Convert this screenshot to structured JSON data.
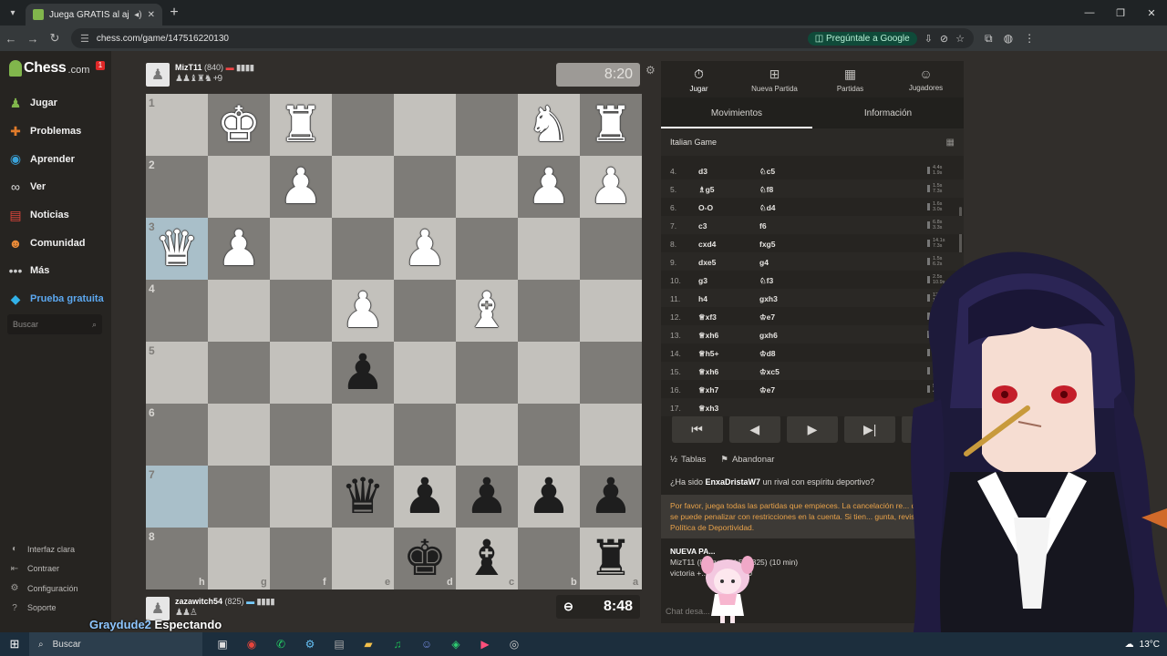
{
  "browser": {
    "tab_title": "Juega GRATIS al ajedrez on",
    "url": "chess.com/game/147516220130",
    "google_chip": "Pregúntale a Google"
  },
  "sidebar": {
    "logo": "Chess",
    "logo_suffix": ".com",
    "notification_count": "1",
    "items": [
      {
        "label": "Jugar",
        "icon": "play-pawn-icon",
        "color": "#81b64c"
      },
      {
        "label": "Problemas",
        "icon": "puzzle-icon",
        "color": "#e07b2b"
      },
      {
        "label": "Aprender",
        "icon": "learn-icon",
        "color": "#3aa2d9"
      },
      {
        "label": "Ver",
        "icon": "binoculars-icon",
        "color": "#dddddd"
      },
      {
        "label": "Noticias",
        "icon": "news-icon",
        "color": "#e0473c"
      },
      {
        "label": "Comunidad",
        "icon": "community-icon",
        "color": "#e98a38"
      },
      {
        "label": "Más",
        "icon": "more-icon",
        "color": "#cccccc"
      },
      {
        "label": "Prueba gratuita",
        "icon": "diamond-icon",
        "color": "#32b1e8"
      }
    ],
    "search_placeholder": "Buscar",
    "footer": [
      {
        "label": "Interfaz clara",
        "icon": "theme-icon"
      },
      {
        "label": "Contraer",
        "icon": "collapse-icon"
      },
      {
        "label": "Configuración",
        "icon": "settings-icon"
      },
      {
        "label": "Soporte",
        "icon": "help-icon"
      }
    ]
  },
  "top_player": {
    "name": "MizT11",
    "rating": "(840)",
    "captured": "♟♟♝♜♞ +9",
    "clock": "8:20"
  },
  "bottom_player": {
    "name": "zazawitch54",
    "rating": "(825)",
    "captured": "♟♟♙",
    "clock": "8:48"
  },
  "board": {
    "ranks": [
      "1",
      "2",
      "3",
      "4",
      "5",
      "6",
      "7",
      "8"
    ],
    "files": [
      "h",
      "g",
      "f",
      "e",
      "d",
      "c",
      "b",
      "a"
    ],
    "highlight": [
      [
        2,
        0
      ],
      [
        6,
        0
      ]
    ],
    "pieces": [
      {
        "r": 0,
        "c": 1,
        "p": "♚",
        "side": "w"
      },
      {
        "r": 0,
        "c": 2,
        "p": "♜",
        "side": "w"
      },
      {
        "r": 0,
        "c": 6,
        "p": "♞",
        "side": "w"
      },
      {
        "r": 0,
        "c": 7,
        "p": "♜",
        "side": "w"
      },
      {
        "r": 1,
        "c": 2,
        "p": "♟",
        "side": "w"
      },
      {
        "r": 1,
        "c": 6,
        "p": "♟",
        "side": "w"
      },
      {
        "r": 1,
        "c": 7,
        "p": "♟",
        "side": "w"
      },
      {
        "r": 2,
        "c": 0,
        "p": "♛",
        "side": "w"
      },
      {
        "r": 2,
        "c": 1,
        "p": "♟",
        "side": "w"
      },
      {
        "r": 2,
        "c": 4,
        "p": "♟",
        "side": "w"
      },
      {
        "r": 3,
        "c": 3,
        "p": "♟",
        "side": "w"
      },
      {
        "r": 3,
        "c": 5,
        "p": "♝",
        "side": "w"
      },
      {
        "r": 4,
        "c": 3,
        "p": "♟",
        "side": "b"
      },
      {
        "r": 6,
        "c": 3,
        "p": "♛",
        "side": "b"
      },
      {
        "r": 6,
        "c": 4,
        "p": "♟",
        "side": "b"
      },
      {
        "r": 6,
        "c": 5,
        "p": "♟",
        "side": "b"
      },
      {
        "r": 6,
        "c": 6,
        "p": "♟",
        "side": "b"
      },
      {
        "r": 6,
        "c": 7,
        "p": "♟",
        "side": "b"
      },
      {
        "r": 7,
        "c": 4,
        "p": "♚",
        "side": "b"
      },
      {
        "r": 7,
        "c": 5,
        "p": "♝",
        "side": "b"
      },
      {
        "r": 7,
        "c": 7,
        "p": "♜",
        "side": "b"
      }
    ]
  },
  "panel": {
    "tabs": [
      {
        "label": "Jugar",
        "icon": "stopwatch-icon"
      },
      {
        "label": "Nueva Partida",
        "icon": "plus-icon"
      },
      {
        "label": "Partidas",
        "icon": "grid-icon"
      },
      {
        "label": "Jugadores",
        "icon": "players-icon"
      }
    ],
    "subtabs": [
      "Movimientos",
      "Información"
    ],
    "opening": "Italian Game",
    "moves": [
      {
        "n": "4.",
        "w": "d3",
        "b": "♘c5",
        "t": "4.4s\n1.9s"
      },
      {
        "n": "5.",
        "w": "♗g5",
        "b": "♘f8",
        "t": "1.5s\n7.3s"
      },
      {
        "n": "6.",
        "w": "O-O",
        "b": "♘d4",
        "t": "1.6s\n3.0s"
      },
      {
        "n": "7.",
        "w": "c3",
        "b": "f6",
        "t": "6.8s\n3.3s"
      },
      {
        "n": "8.",
        "w": "cxd4",
        "b": "fxg5",
        "t": "14.1s\n7.3s"
      },
      {
        "n": "9.",
        "w": "dxe5",
        "b": "g4",
        "t": "1.5s\n6.2s"
      },
      {
        "n": "10.",
        "w": "g3",
        "b": "♘f3",
        "t": "2.5s\n10.9s"
      },
      {
        "n": "11.",
        "w": "h4",
        "b": "gxh3",
        "t": "12.8s\n10.3s"
      },
      {
        "n": "12.",
        "w": "♕xf3",
        "b": "♔e7",
        "t": "11.5s\n5.5s"
      },
      {
        "n": "13.",
        "w": "♕xh6",
        "b": "gxh6",
        "t": "4.0s\n2.8s"
      },
      {
        "n": "14.",
        "w": "♕h5+",
        "b": "♔d8",
        "t": "4.0s\n2.1s"
      },
      {
        "n": "15.",
        "w": "♕xh6",
        "b": "♔xc5",
        "t": "8.7s\n1.5s"
      },
      {
        "n": "16.",
        "w": "♕xh7",
        "b": "♔e7",
        "t": "5.0s\n4.2s"
      },
      {
        "n": "17.",
        "w": "♕xh3",
        "b": "",
        "t": "8.1s"
      }
    ],
    "controls": [
      "⏮",
      "◀",
      "▶",
      "▶|",
      "⏭"
    ],
    "draw_label": "Tablas",
    "resign_label": "Abandonar",
    "sporty_prefix": "¿Ha sido",
    "sporty_user": "EnxaDristaW7",
    "sporty_suffix": "un rival con espíritu deportivo?",
    "warning": "Por favor, juega todas las partidas que empieces. La cancelación re... de partidas se puede penalizar con restricciones en la cuenta. Si tien... gunta, revisa nuestra Política de Deportividad.",
    "new_game_title": "NUEVA PA...",
    "new_game_line": "MizT11 (8... zawitch54 (825) (10 min)",
    "new_game_result": "victoria +... / derrota -50",
    "chat_placeholder": "Chat desa..."
  },
  "overlay_text": {
    "user": "Graydude2",
    "status": "Espectando"
  },
  "taskbar": {
    "search": "Buscar",
    "temp": "13°C",
    "apps": [
      {
        "icon": "task-view-icon",
        "color": "#dddddd",
        "glyph": "▣"
      },
      {
        "icon": "chrome-icon",
        "color": "#e8453c",
        "glyph": "◉"
      },
      {
        "icon": "whatsapp-icon",
        "color": "#25d366",
        "glyph": "✆"
      },
      {
        "icon": "steam-icon",
        "color": "#66c0f4",
        "glyph": "⚙"
      },
      {
        "icon": "app-icon",
        "color": "#aaaaaa",
        "glyph": "▤"
      },
      {
        "icon": "folder-icon",
        "color": "#f3c04a",
        "glyph": "▰"
      },
      {
        "icon": "spotify-icon",
        "color": "#1db954",
        "glyph": "♫"
      },
      {
        "icon": "discord-icon",
        "color": "#7289da",
        "glyph": "☺"
      },
      {
        "icon": "game-icon",
        "color": "#2ecc71",
        "glyph": "◈"
      },
      {
        "icon": "media-icon",
        "color": "#ff4f7b",
        "glyph": "▶"
      },
      {
        "icon": "obs-icon",
        "color": "#cccccc",
        "glyph": "◎"
      }
    ]
  }
}
